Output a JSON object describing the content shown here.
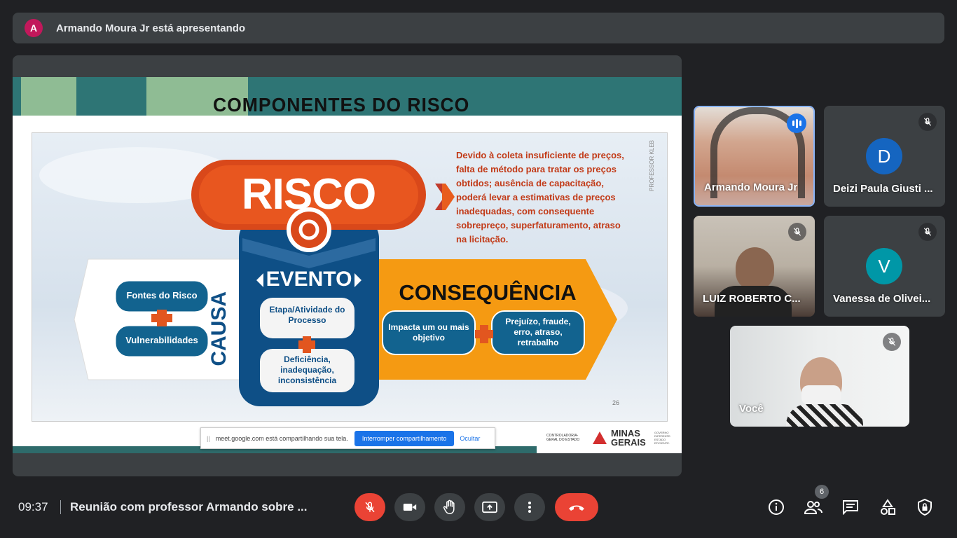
{
  "banner": {
    "avatar_initial": "A",
    "text": "Armando Moura Jr está apresentando"
  },
  "slide": {
    "title": "COMPONENTES DO RISCO",
    "risco": "RISCO",
    "description": "Devido à coleta insuficiente de preços, falta de método para tratar os preços obtidos; ausência de capacitação, poderá levar a estimativas de preços inadequadas, com consequente sobrepreço, superfaturamento, atraso na licitação.",
    "causa": "CAUSA",
    "fontes": "Fontes do Risco",
    "vulnerabilidades": "Vulnerabilidades",
    "evento": "EVENTO",
    "etapa": "Etapa/Atividade do Processo",
    "deficiencia": "Deficiência, inadequação, inconsistência",
    "consequencia": "CONSEQUÊNCIA",
    "impacta": "Impacta um ou mais objetivo",
    "prejuizo": "Prejuízo, fraude, erro, atraso, retrabalho",
    "page": "26",
    "vertical_label": "PROFESSOR KLEB",
    "footer_cge": "CONTROLADORIA-GERAL DO ESTADO",
    "footer_mg": "MINAS GERAIS",
    "footer_gov": "GOVERNO DIFERENTE. ESTADO EFICIENTE."
  },
  "share_bar": {
    "grip": "||",
    "message": "meet.google.com está compartilhando sua tela.",
    "stop": "Interromper compartilhamento",
    "hide": "Ocultar"
  },
  "participants": [
    {
      "name": "Armando Moura Jr"
    },
    {
      "name": "Deizi Paula Giusti ...",
      "initial": "D",
      "color": "#1565c0"
    },
    {
      "name": "LUIZ ROBERTO C..."
    },
    {
      "name": "Vanessa de Olivei...",
      "initial": "V",
      "color": "#0097a7"
    },
    {
      "name": "Você"
    }
  ],
  "bottom": {
    "time": "09:37",
    "meeting_title": "Reunião com professor Armando sobre ...",
    "people_count": "6"
  }
}
